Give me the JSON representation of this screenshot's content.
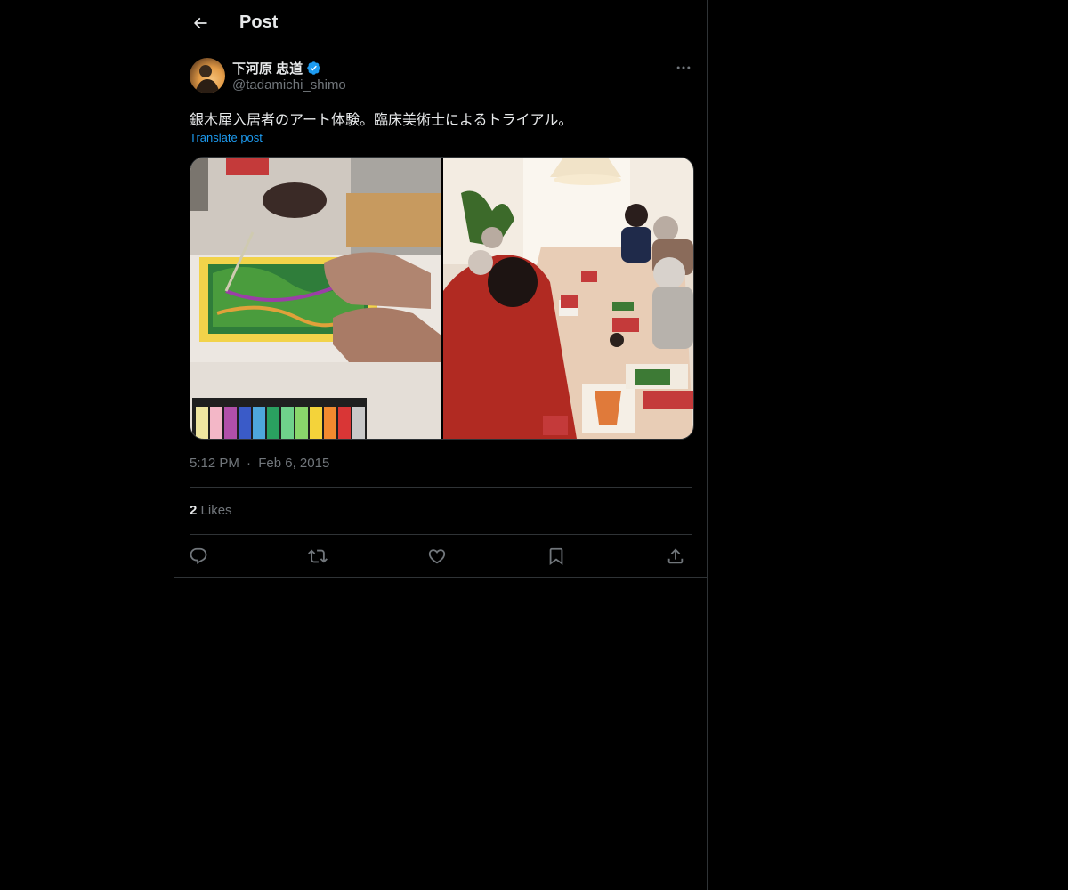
{
  "header": {
    "title": "Post",
    "back_icon": "arrow-left-icon"
  },
  "author": {
    "name": "下河原 忠道",
    "handle": "@tadamichi_shimo",
    "verified": true,
    "verified_color": "#1d9bf0"
  },
  "post": {
    "text": "銀木犀入居者のアート体験。臨床美術士によるトライアル。",
    "translate_label": "Translate post",
    "time": "5:12 PM",
    "separator": "·",
    "date": "Feb 6, 2015",
    "likes_count": "2",
    "likes_label": "Likes"
  },
  "actions": [
    "reply-icon",
    "repost-icon",
    "like-icon",
    "bookmark-icon",
    "share-icon"
  ],
  "colors": {
    "background": "#000000",
    "text": "#e7e9ea",
    "secondary_text": "#71767b",
    "border": "#2f3336",
    "accent": "#1d9bf0"
  }
}
